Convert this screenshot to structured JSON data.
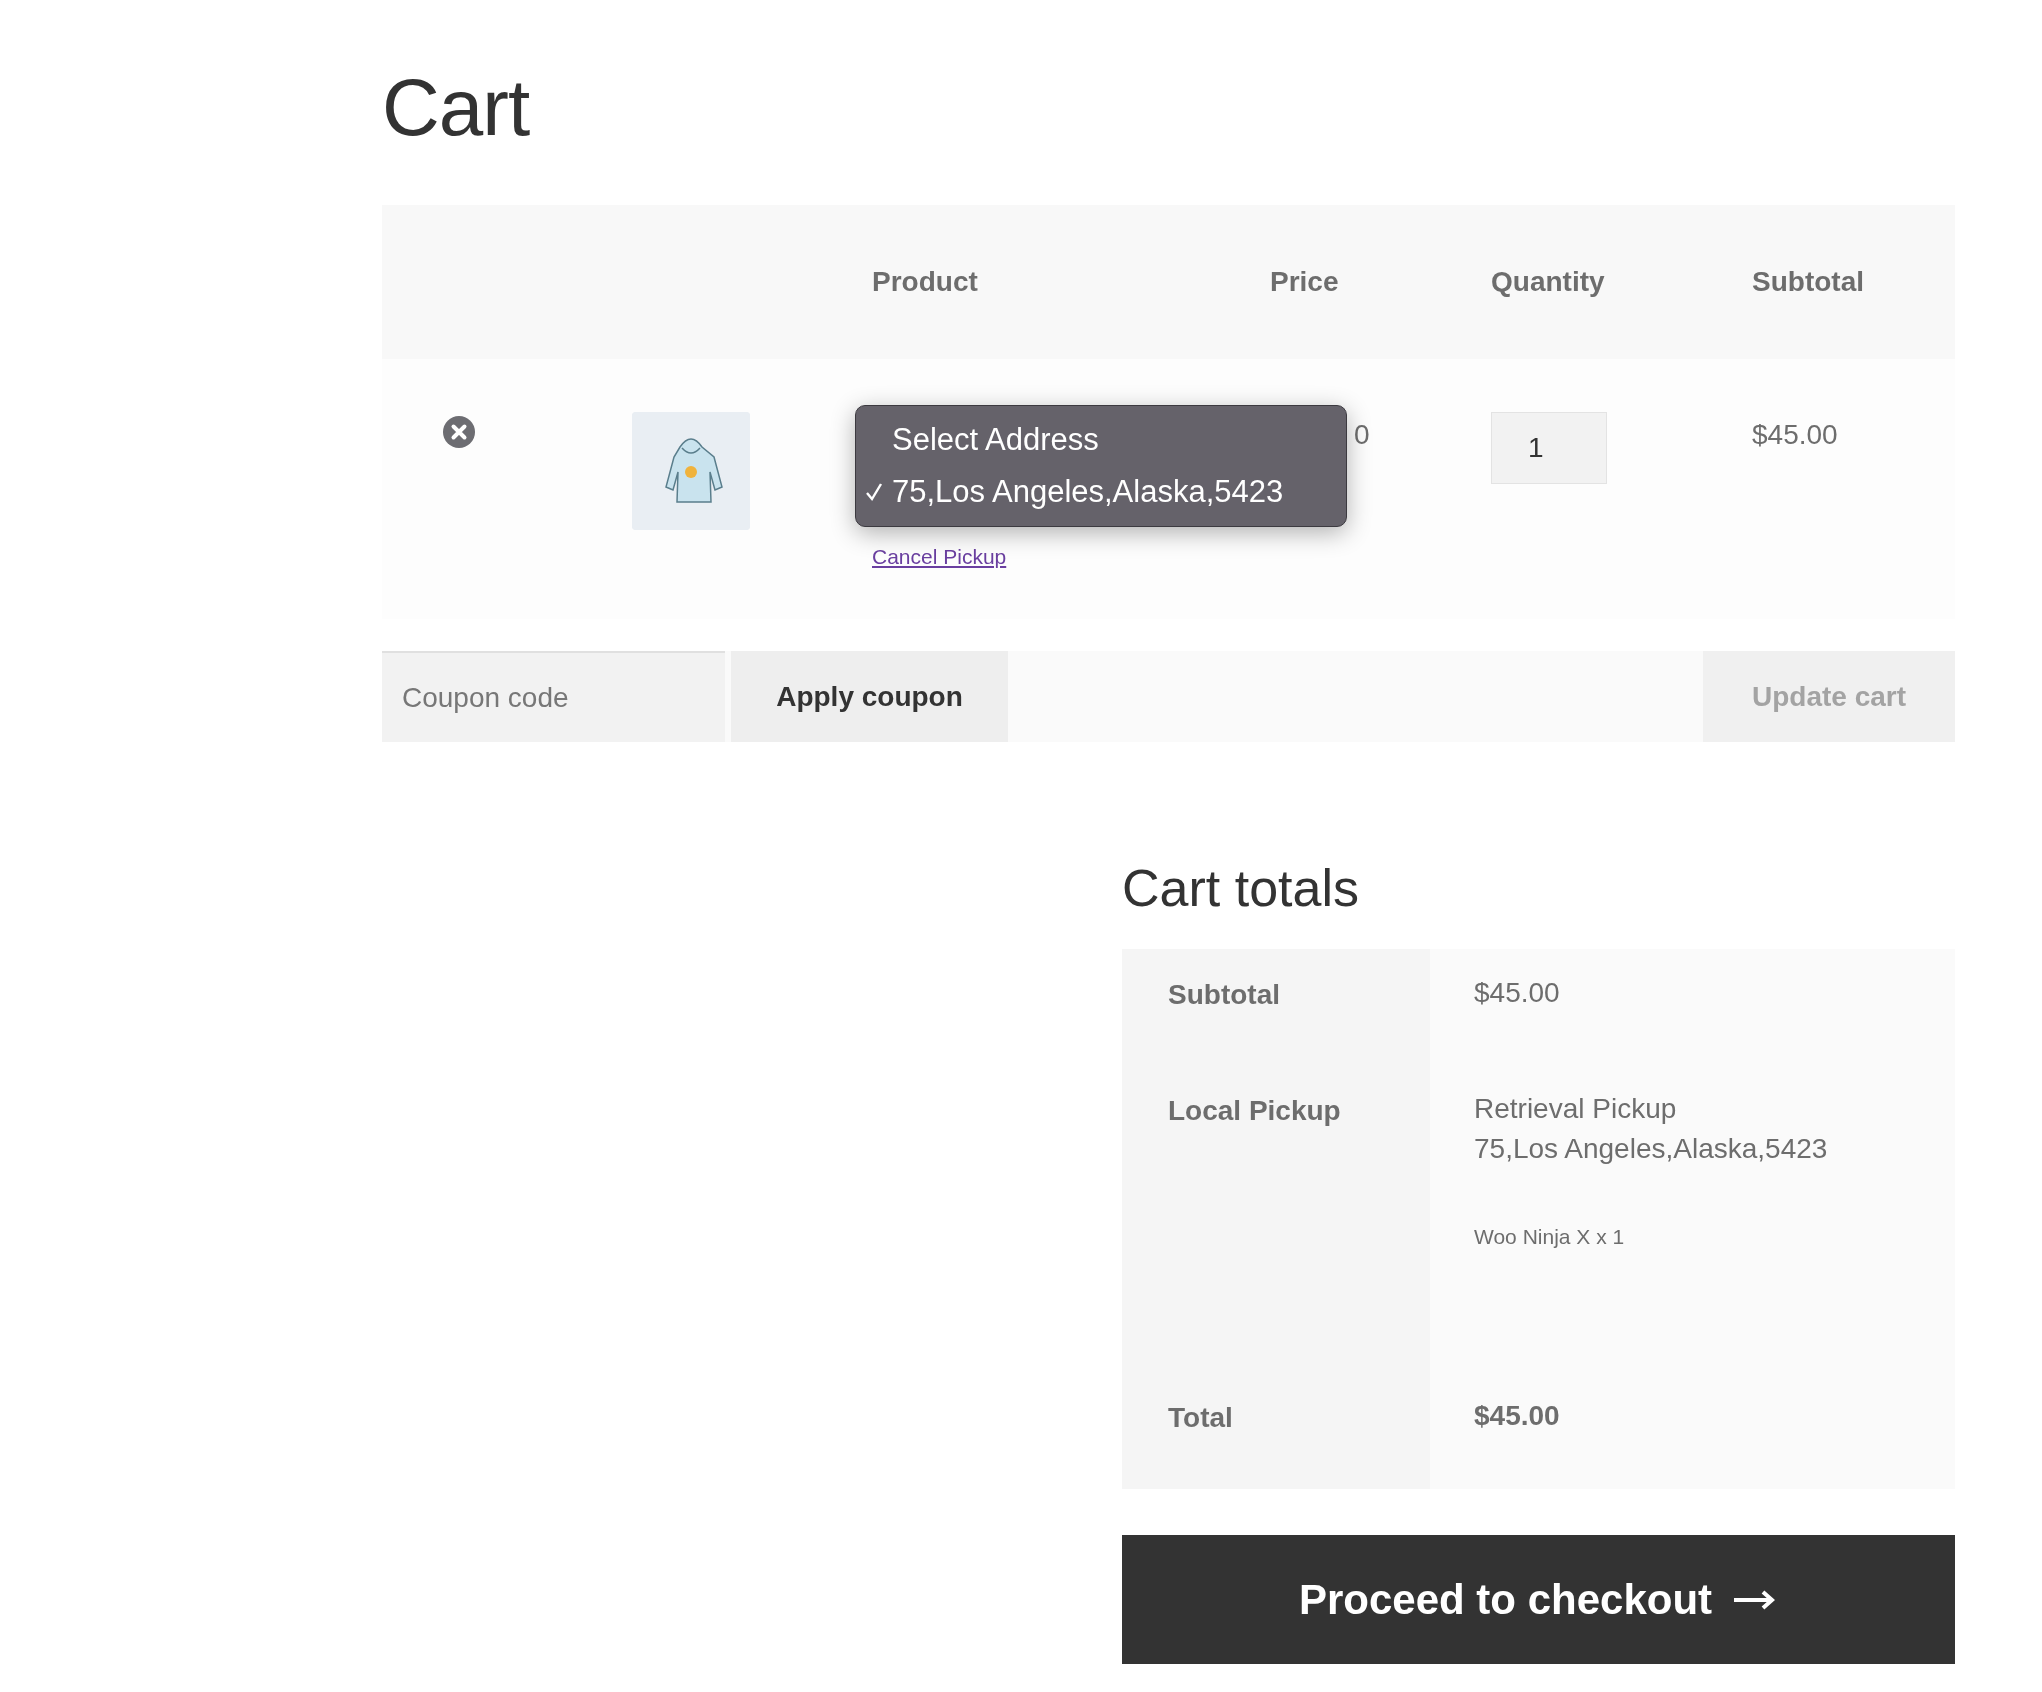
{
  "page_title": "Cart",
  "table": {
    "columns": [
      {
        "label": "Product"
      },
      {
        "label": "Price"
      },
      {
        "label": "Quantity"
      },
      {
        "label": "Subtotal"
      }
    ],
    "rows": [
      {
        "kind": "product",
        "price": "0",
        "quantity": "1",
        "subtotal": "$45.00",
        "cancel_link": "Cancel Pickup",
        "address_menu": {
          "options": [
            {
              "label": "Select Address",
              "selected": false
            },
            {
              "label": "75,Los Angeles,Alaska,5423",
              "selected": true
            }
          ]
        }
      }
    ]
  },
  "coupon": {
    "placeholder": "Coupon code",
    "apply_button": "Apply coupon",
    "update_button": "Update cart",
    "update_disabled": true
  },
  "totals": {
    "title": "Cart totals",
    "rows": [
      {
        "label": "Subtotal",
        "lines": [
          {
            "text": "$45.00",
            "kind": "value"
          }
        ]
      },
      {
        "label": "Local Pickup",
        "lines": [
          {
            "text": "Retrieval Pickup",
            "kind": "value"
          },
          {
            "text": "75,Los Angeles,Alaska,5423",
            "kind": "value"
          },
          {
            "text": "Woo Ninja X x 1",
            "kind": "note"
          }
        ]
      },
      {
        "label": "Total",
        "lines": [
          {
            "text": "$45.00",
            "kind": "strong"
          }
        ]
      }
    ]
  },
  "checkout_button": "Proceed to checkout"
}
